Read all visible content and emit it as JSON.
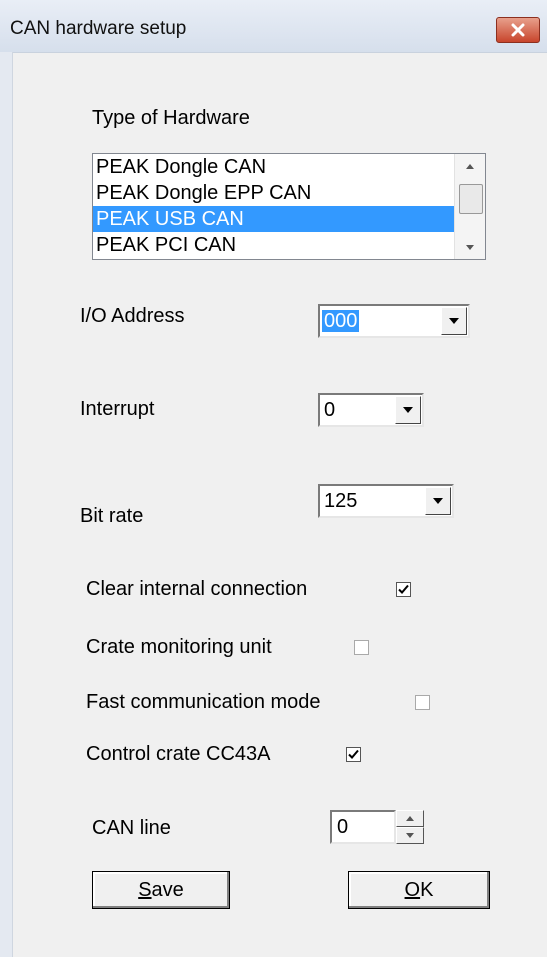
{
  "window": {
    "title": "CAN hardware setup",
    "close_icon": "close-x-icon",
    "close_color": "#c8452c"
  },
  "hardware": {
    "label": "Type of Hardware",
    "items": [
      "PEAK Dongle CAN",
      "PEAK Dongle EPP CAN",
      "PEAK USB CAN",
      "PEAK PCI CAN"
    ],
    "selected": "PEAK USB CAN",
    "selected_color": "#3399ff"
  },
  "io_address": {
    "label": "I/O Address",
    "value": "000"
  },
  "interrupt": {
    "label": "Interrupt",
    "value": "0"
  },
  "bit_rate": {
    "label": "Bit rate",
    "value": "125"
  },
  "options": [
    {
      "label": "Clear internal connection",
      "checked": true
    },
    {
      "label": "Crate monitoring unit",
      "checked": false
    },
    {
      "label": "Fast communication mode",
      "checked": false
    },
    {
      "label": "Control crate CC43A",
      "checked": true
    }
  ],
  "can_line": {
    "label": "CAN line",
    "value": "0"
  },
  "buttons": {
    "save_mnemonic": "S",
    "save_rest": "ave",
    "ok_mnemonic": "O",
    "ok_rest": "K"
  }
}
